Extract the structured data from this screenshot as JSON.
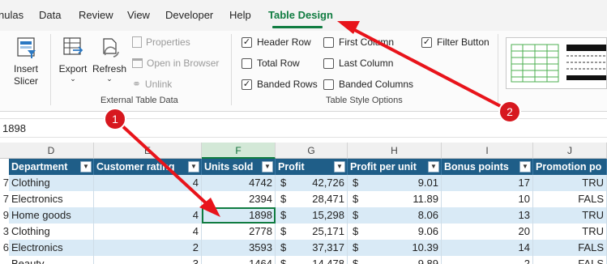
{
  "tabs": [
    "nulas",
    "Data",
    "Review",
    "View",
    "Developer",
    "Help",
    "Table Design"
  ],
  "active_tab": "Table Design",
  "ribbon": {
    "insert_slicer": "Insert Slicer",
    "export": "Export",
    "refresh": "Refresh",
    "properties": "Properties",
    "open_in_browser": "Open in Browser",
    "unlink": "Unlink",
    "external_group": "External Table Data",
    "style_options_group": "Table Style Options",
    "options": {
      "header_row": "Header Row",
      "total_row": "Total Row",
      "banded_rows": "Banded Rows",
      "first_column": "First Column",
      "last_column": "Last Column",
      "banded_columns": "Banded Columns",
      "filter_button": "Filter Button"
    },
    "checked": {
      "header_row": true,
      "total_row": false,
      "banded_rows": true,
      "first_column": false,
      "last_column": false,
      "banded_columns": false,
      "filter_button": true
    }
  },
  "formula_value": "1898",
  "columns": [
    "D",
    "E",
    "F",
    "G",
    "H",
    "I",
    "J"
  ],
  "selected_column": "F",
  "headers": [
    "Department",
    "Customer rating",
    "Units sold",
    "Profit",
    "Profit per unit",
    "Bonus points",
    "Promotion po"
  ],
  "rows": [
    {
      "rn": "7",
      "dept": "Clothing",
      "rating": "4",
      "units": "4742",
      "profit": "42,726",
      "ppu": "9.01",
      "bonus": "17",
      "promo": "TRU"
    },
    {
      "rn": "7",
      "dept": "Electronics",
      "rating": "",
      "units": "2394",
      "profit": "28,471",
      "ppu": "11.89",
      "bonus": "10",
      "promo": "FALS"
    },
    {
      "rn": "9",
      "dept": "Home goods",
      "rating": "4",
      "units": "1898",
      "profit": "15,298",
      "ppu": "8.06",
      "bonus": "13",
      "promo": "TRU"
    },
    {
      "rn": "3",
      "dept": "Clothing",
      "rating": "4",
      "units": "2778",
      "profit": "25,171",
      "ppu": "9.06",
      "bonus": "20",
      "promo": "TRU"
    },
    {
      "rn": "6",
      "dept": "Electronics",
      "rating": "2",
      "units": "3593",
      "profit": "37,317",
      "ppu": "10.39",
      "bonus": "14",
      "promo": "FALS"
    },
    {
      "rn": "",
      "dept": "Beauty",
      "rating": "3",
      "units": "1464",
      "profit": "14,478",
      "ppu": "9.89",
      "bonus": "2",
      "promo": "FALS"
    }
  ],
  "currency": "$",
  "annotations": {
    "badge1": "1",
    "badge2": "2"
  },
  "colors": {
    "accent": "#107c41",
    "table_header": "#1f5e88",
    "band": "#d9eaf6",
    "arrow": "#e8141b"
  }
}
